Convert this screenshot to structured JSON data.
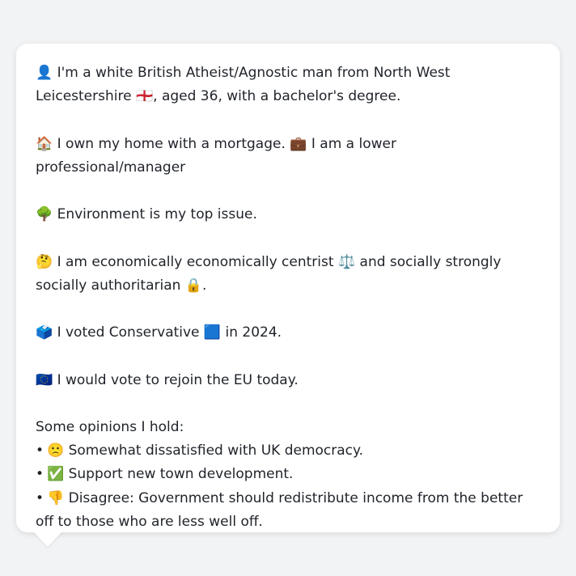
{
  "profile": {
    "identity": {
      "emoji": "👤",
      "text_before": "I'm a white British Atheist/Agnostic man from North West Leicestershire",
      "flag": "🏴󠁧󠁢󠁥󠁮󠁧󠁿",
      "text_after": ", aged 36, with a bachelor's degree."
    },
    "housing": {
      "home_emoji": "🏠",
      "home_text": "I own my home with a mortgage.",
      "work_emoji": "💼",
      "work_text": "I am a lower professional/manager"
    },
    "top_issue": {
      "emoji": "🌳",
      "text": "Environment is my top issue."
    },
    "ideology": {
      "emoji": "🤔",
      "text_before": "I am economically economically centrist",
      "scale_emoji": "⚖️",
      "text_middle": "and socially strongly socially authoritarian",
      "lock_emoji": "🔒",
      "text_after": "."
    },
    "vote": {
      "emoji": "🗳️",
      "text_before": "I voted Conservative",
      "party_emoji": "🟦",
      "text_after": "in 2024."
    },
    "eu": {
      "emoji": "🇪🇺",
      "text": "I would vote to rejoin the EU today."
    },
    "opinions": {
      "heading": "Some opinions I hold:",
      "bullet": "•",
      "items": [
        {
          "emoji": "🙁",
          "text": "Somewhat dissatisfied with UK democracy."
        },
        {
          "emoji": "✅",
          "text": "Support new town development."
        },
        {
          "emoji": "👎",
          "text": "Disagree: Government should redistribute income from the better off to those who are less well off."
        }
      ]
    }
  }
}
